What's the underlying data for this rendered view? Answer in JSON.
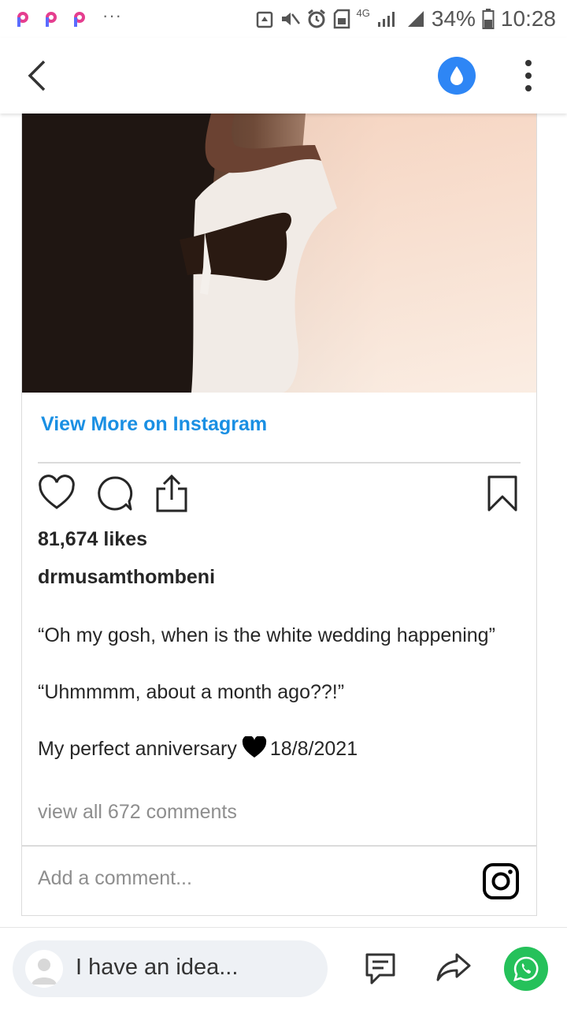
{
  "status_bar": {
    "notification_icons": [
      "app-p-icon",
      "app-p-icon",
      "app-p-icon"
    ],
    "more_indicator": "···",
    "network_label": "4G",
    "battery": "34%",
    "time": "10:28",
    "accent_color": "#e53e8f"
  },
  "app_bar": {
    "back_icon": "chevron-left-icon",
    "drop_icon": "water-drop-icon",
    "drop_color": "#2e86f5",
    "more_icon": "vertical-dots-icon"
  },
  "post": {
    "view_more_label": "View More on Instagram",
    "link_color": "#1a8fe3",
    "likes": "81,674 likes",
    "username": "drmusamthombeni",
    "caption": {
      "line1": "“Oh my gosh, when is the white wedding happening”",
      "line2": "“Uhmmmm, about a month ago??!”",
      "line3_before": "My perfect anniversary",
      "line3_emoji": "black-heart-icon",
      "line3_after": "18/8/2021"
    },
    "view_comments": "view all 672 comments",
    "comment_placeholder": "Add a comment...",
    "icons": [
      "heart-icon",
      "comment-icon",
      "share-icon",
      "bookmark-icon",
      "instagram-icon"
    ]
  },
  "bottom_bar": {
    "idea_placeholder": "I have an idea...",
    "whatsapp_color": "#25c15a"
  }
}
